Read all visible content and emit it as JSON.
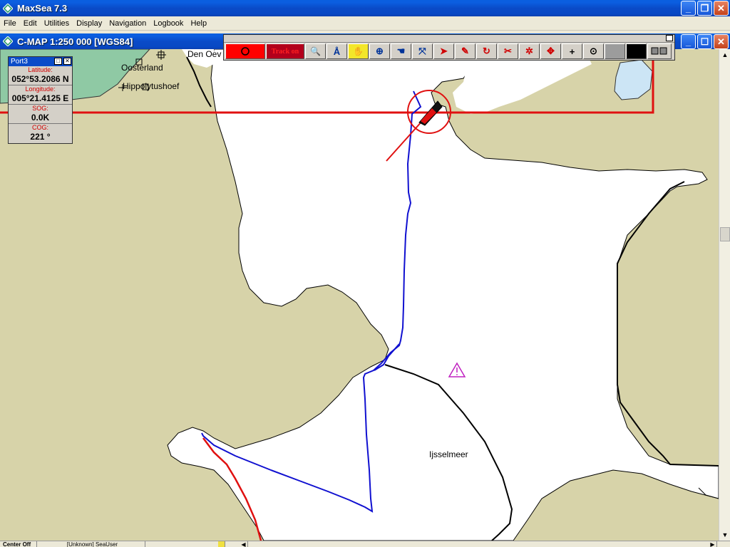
{
  "app": {
    "title": "MaxSea 7.3",
    "minimize": "_",
    "restore": "❐",
    "close": "✕"
  },
  "menu": [
    "File",
    "Edit",
    "Utilities",
    "Display",
    "Navigation",
    "Logbook",
    "Help"
  ],
  "document": {
    "title": "C-MAP  1:250 000 [WGS84]"
  },
  "toolbar": {
    "track_label": "Track on",
    "buttons": [
      {
        "icon": "target-icon",
        "glyph": "◎"
      },
      {
        "icon": "track-on",
        "glyph": ""
      },
      {
        "icon": "zoom-icon",
        "glyph": "🔍"
      },
      {
        "icon": "compass-divider-icon",
        "glyph": "Å"
      },
      {
        "icon": "hand-icon",
        "glyph": "✋"
      },
      {
        "icon": "crosshair-icon",
        "glyph": "⊕"
      },
      {
        "icon": "grab-icon",
        "glyph": "☚"
      },
      {
        "icon": "measure-icon",
        "glyph": "⤧"
      },
      {
        "icon": "pointer-icon",
        "glyph": "➤"
      },
      {
        "icon": "pencil-icon",
        "glyph": "✎"
      },
      {
        "icon": "rotate-icon",
        "glyph": "↻"
      },
      {
        "icon": "scissors-icon",
        "glyph": "✂"
      },
      {
        "icon": "scatter-icon",
        "glyph": "✲"
      },
      {
        "icon": "move-icon",
        "glyph": "✥"
      },
      {
        "icon": "plus-icon",
        "glyph": "+"
      },
      {
        "icon": "center-icon",
        "glyph": "⊙"
      }
    ]
  },
  "port_panel": {
    "title": "Port3",
    "latitude_label": "Latitude:",
    "latitude_value": "052°53.2086 N",
    "longitude_label": "Longitude:",
    "longitude_value": "005°21.4125 E",
    "sog_label": "SOG:",
    "sog_value": "0.0K",
    "cog_label": "COG:",
    "cog_value": "221 °"
  },
  "map": {
    "labels": {
      "oosterland": "Oosterland",
      "hippolytushoef": "Hippolytushoef",
      "den_oever": "Den Oev",
      "ijsselmeer": "Ijsselmeer"
    },
    "colors": {
      "land": "#d7d3a9",
      "water": "#ffffff",
      "track_blue": "#1010d0",
      "route_red": "#e01010",
      "green_land": "#8fc9a4",
      "lake": "#cce5f5",
      "warning": "#c020c0"
    }
  },
  "status": {
    "cell1": "Center Off",
    "cell2": "[Unknown] SeaUser"
  }
}
